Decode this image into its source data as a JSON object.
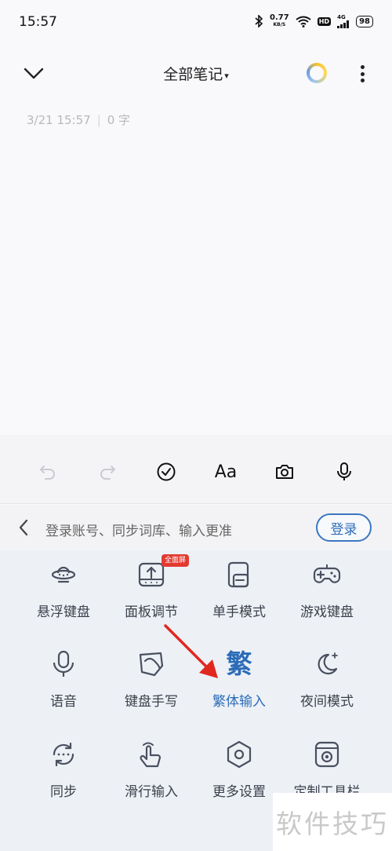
{
  "status_bar": {
    "time": "15:57",
    "net_speed": "0.77",
    "net_speed_unit": "KB/S",
    "hd": "HD",
    "network": "4G",
    "battery": "98"
  },
  "header": {
    "title": "全部笔记",
    "caret": "▾"
  },
  "note": {
    "date": "3/21 15:57",
    "separator": "|",
    "word_count": "0 字"
  },
  "toolbar": {
    "font_label": "Aa"
  },
  "login_bar": {
    "prompt": "登录账号、同步词库、输入更准",
    "login_label": "登录"
  },
  "grid": [
    {
      "label": "悬浮键盘"
    },
    {
      "label": "面板调节",
      "badge": "全面屏"
    },
    {
      "label": "单手模式"
    },
    {
      "label": "游戏键盘"
    },
    {
      "label": "语音"
    },
    {
      "label": "键盘手写"
    },
    {
      "label": "繁体输入",
      "glyph": "繁"
    },
    {
      "label": "夜间模式"
    },
    {
      "label": "同步"
    },
    {
      "label": "滑行输入"
    },
    {
      "label": "更多设置"
    },
    {
      "label": "定制工具栏"
    }
  ],
  "colors": {
    "accent": "#2c6cb8",
    "arrow": "#e0281f",
    "badge": "#e23a31"
  },
  "watermark": "软件技巧"
}
